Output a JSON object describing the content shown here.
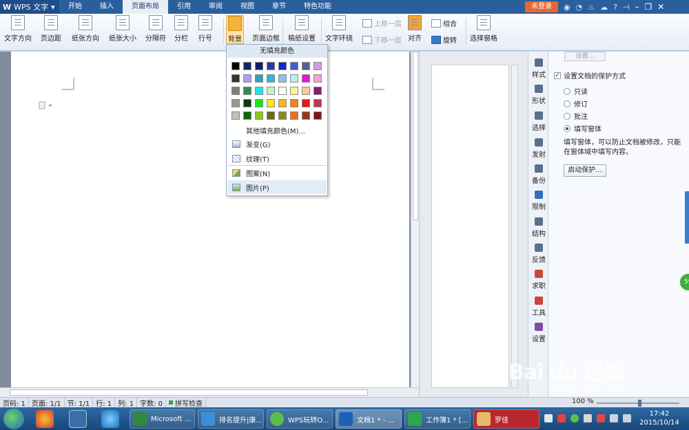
{
  "titlebar": {
    "app_name": "WPS 文字",
    "tabs": [
      "开始",
      "插入",
      "页面布局",
      "引用",
      "审阅",
      "视图",
      "章节",
      "特色功能"
    ],
    "active_tab": "页面布局",
    "login": "未登录"
  },
  "ribbon": {
    "text_direction": "文字方向",
    "margins": "页边距",
    "orientation": "纸张方向",
    "paper_size": "纸张大小",
    "separator": "分隔符",
    "columns": "分栏",
    "line_number": "行号",
    "background": "背景",
    "page_border": "页面边框",
    "manuscript": "稿纸设置",
    "text_wrap": "文字环绕",
    "bring_forward": "上移一层",
    "send_backward": "下移一层",
    "align": "对齐",
    "group": "组合",
    "rotate": "旋转",
    "selection_pane": "选择窗格"
  },
  "dropdown": {
    "no_fill": "无填充颜色",
    "more_colors": "其他填充颜色(M)...",
    "gradient": "渐变(G)",
    "texture": "纹理(T)",
    "pattern": "图案(N)",
    "picture": "图片(P)",
    "colors": [
      "#000000",
      "#0d2a5c",
      "#0f1f6b",
      "#2b3a9e",
      "#1326d8",
      "#3d60d9",
      "#55648c",
      "#d39ce8",
      "#333333",
      "#a9a0e8",
      "#2aa5b4",
      "#29b7e8",
      "#86c4e8",
      "#b4f0f8",
      "#e814d8",
      "#f2a0d8",
      "#7f7f7f",
      "#2f8a5a",
      "#18e8e8",
      "#c8f0c0",
      "#ffffff",
      "#f8f490",
      "#f8c89a",
      "#8a1a70",
      "#999999",
      "#0a3a0a",
      "#18e818",
      "#f8e818",
      "#f8b818",
      "#f88018",
      "#e81818",
      "#b83858",
      "#bfbfbf",
      "#0a6a0a",
      "#8ac818",
      "#686818",
      "#8a8a18",
      "#e87018",
      "#983818",
      "#781818"
    ]
  },
  "side_tabs": [
    "样式",
    "形状",
    "选择",
    "发射",
    "备份",
    "限制",
    "结构",
    "反馈",
    "求职",
    "工具",
    "设置"
  ],
  "right_panel": {
    "setting_button": "设置...",
    "protect_checkbox": "设置文档的保护方式",
    "options": [
      "只读",
      "修订",
      "批注",
      "填写窗体"
    ],
    "selected_option": "填写窗体",
    "description": "填写窗体，可以防止文档被修改，只能在窗体域中填写内容。",
    "start_button": "启动保护...",
    "badge": "59"
  },
  "statusbar": {
    "page": "页码: 1",
    "pages": "页面: 1/1",
    "section": "节: 1/1",
    "row": "行: 1",
    "col": "列: 1",
    "words": "字数: 0",
    "spell": "拼写检查",
    "zoom": "100 %"
  },
  "taskbar": {
    "items": [
      "Microsoft ...",
      "排名提升|康...",
      "WPS玩转O...",
      "文档1 * - ...",
      "工作簿1 * [...",
      "罗佳"
    ],
    "time": "17:42",
    "date": "2015/10/14"
  },
  "watermark": {
    "brand": "Bai du 经验",
    "url": "jingyan.baidu.com"
  }
}
